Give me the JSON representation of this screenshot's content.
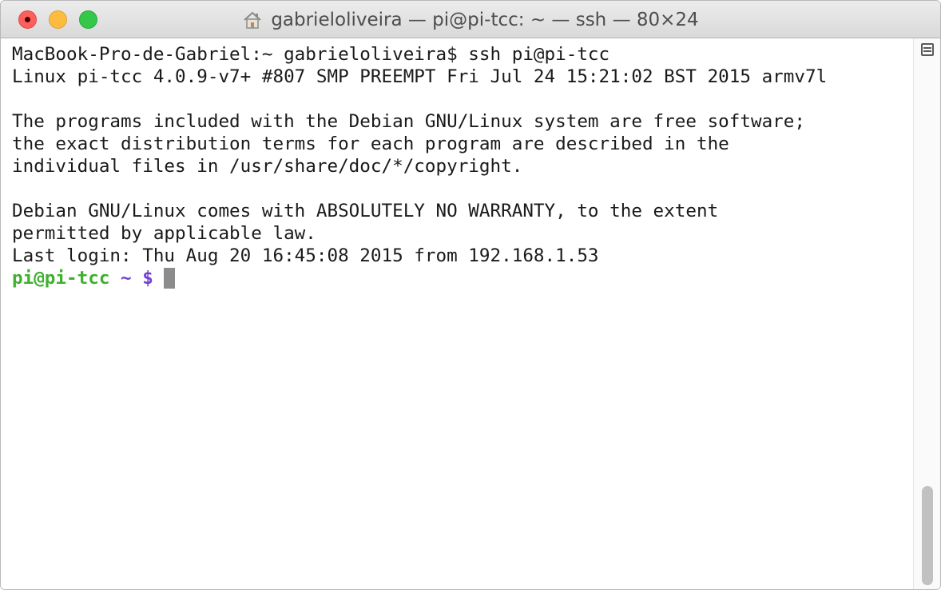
{
  "window": {
    "title": "gabrieloliveira — pi@pi-tcc: ~ — ssh — 80×24",
    "title_icon": "home-icon"
  },
  "terminal": {
    "lines": [
      "MacBook-Pro-de-Gabriel:~ gabrieloliveira$ ssh pi@pi-tcc",
      "Linux pi-tcc 4.0.9-v7+ #807 SMP PREEMPT Fri Jul 24 15:21:02 BST 2015 armv7l",
      "",
      "The programs included with the Debian GNU/Linux system are free software;",
      "the exact distribution terms for each program are described in the",
      "individual files in /usr/share/doc/*/copyright.",
      "",
      "Debian GNU/Linux comes with ABSOLUTELY NO WARRANTY, to the extent",
      "permitted by applicable law.",
      "Last login: Thu Aug 20 16:45:08 2015 from 192.168.1.53"
    ],
    "prompt": {
      "user_host": "pi@pi-tcc",
      "path_symbol": " ~ $ "
    }
  },
  "colors": {
    "prompt_user": "#3fb02f",
    "prompt_symbol": "#6e3fd1",
    "close": "#fc605c",
    "minimize": "#fdbc40",
    "zoom": "#34c84a"
  }
}
